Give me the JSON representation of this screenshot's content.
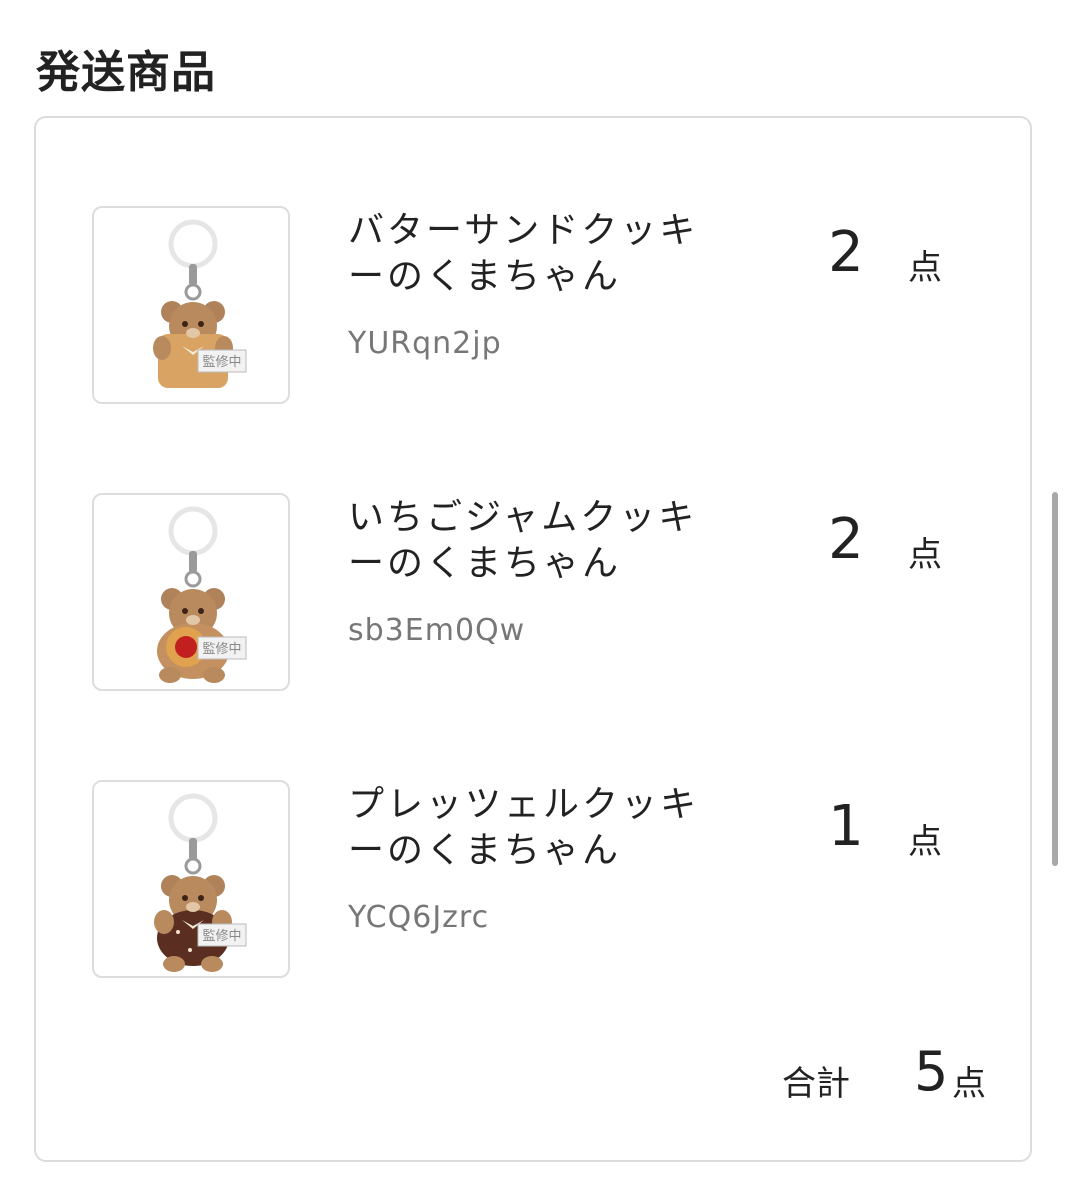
{
  "section": {
    "title": "発送商品"
  },
  "items": [
    {
      "name": "バターサンドクッキーのくまちゃん",
      "code": "YURqn2jp",
      "qty": "2",
      "unit": "点",
      "image_icon": "bear-keychain-butter-sandwich",
      "cookie_color": "#d9a463",
      "stamp": "監修中"
    },
    {
      "name": "いちごジャムクッキーのくまちゃん",
      "code": "sb3Em0Qw",
      "qty": "2",
      "unit": "点",
      "image_icon": "bear-keychain-strawberry-jam",
      "cookie_color": "#e0a24e",
      "stamp": "監修中"
    },
    {
      "name": "プレッツェルクッキーのくまちゃん",
      "code": "YCQ6Jzrc",
      "qty": "1",
      "unit": "点",
      "image_icon": "bear-keychain-pretzel",
      "cookie_color": "#5a2f22",
      "stamp": "監修中"
    }
  ],
  "total": {
    "label": "合計",
    "value": "5",
    "unit": "点"
  },
  "colors": {
    "bear": "#b0825a",
    "border": "#dcdcdc",
    "code_text": "#777777"
  }
}
